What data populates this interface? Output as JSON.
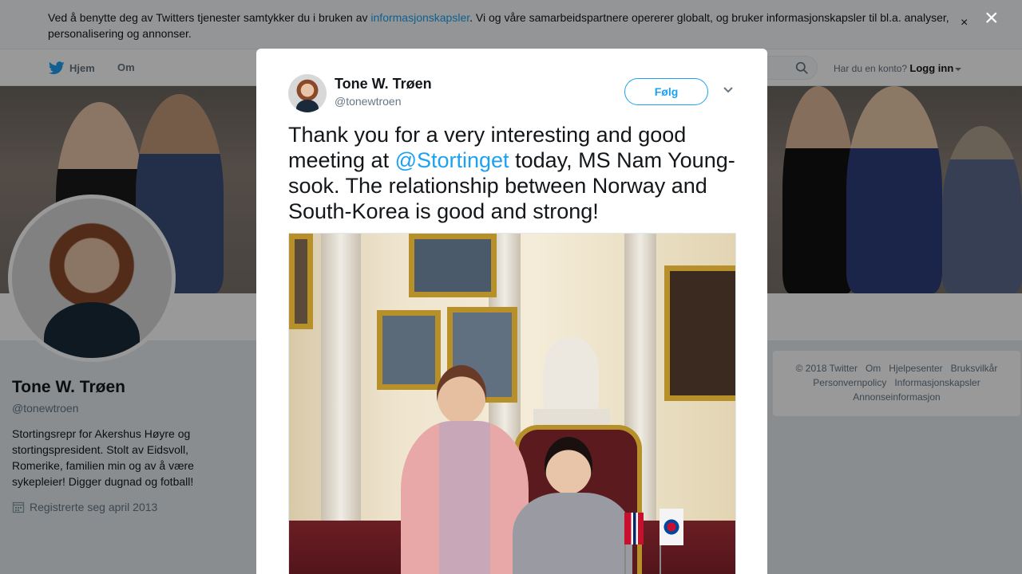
{
  "cookie_banner": {
    "text_before": "Ved å benytte deg av Twitters tjenester samtykker du i bruken av ",
    "link": "informasjonskapsler",
    "text_after": ". Vi og våre samarbeidspartnere opererer globalt, og bruker informasjonskapsler til bl.a. analyser, personalisering og annonser.",
    "close": "×"
  },
  "nav": {
    "home": "Hjem",
    "about": "Om",
    "account_prompt": "Har du en konto?",
    "login": "Logg inn"
  },
  "profile": {
    "name": "Tone W. Trøen",
    "handle": "@tonewtroen",
    "bio": "Stortingsrepr for Akershus Høyre og stortingspresident. Stolt av Eidsvoll, Romerike, familien min og av å være sykepleier! Digger dugnad og fotball!",
    "joined": "Registrerte seg april 2013"
  },
  "footer": {
    "links_row1": [
      "© 2018 Twitter",
      "Om",
      "Hjelpesenter",
      "Bruksvilkår"
    ],
    "links_row2": [
      "Personvernpolicy",
      "Informasjonskapsler"
    ],
    "links_row3": [
      "Annonseinformasjon"
    ]
  },
  "modal": {
    "close": "×",
    "author_name": "Tone W. Trøen",
    "author_handle": "@tonewtroen",
    "follow_label": "Følg",
    "tweet_before": "Thank you for a very interesting and good meeting at ",
    "tweet_mention": "@Stortinget",
    "tweet_after": " today, MS Nam Young-sook. The relationship between Norway and South-Korea is good and strong!"
  },
  "colors": {
    "accent": "#1da1f2",
    "text": "#14171a",
    "muted": "#657786"
  }
}
